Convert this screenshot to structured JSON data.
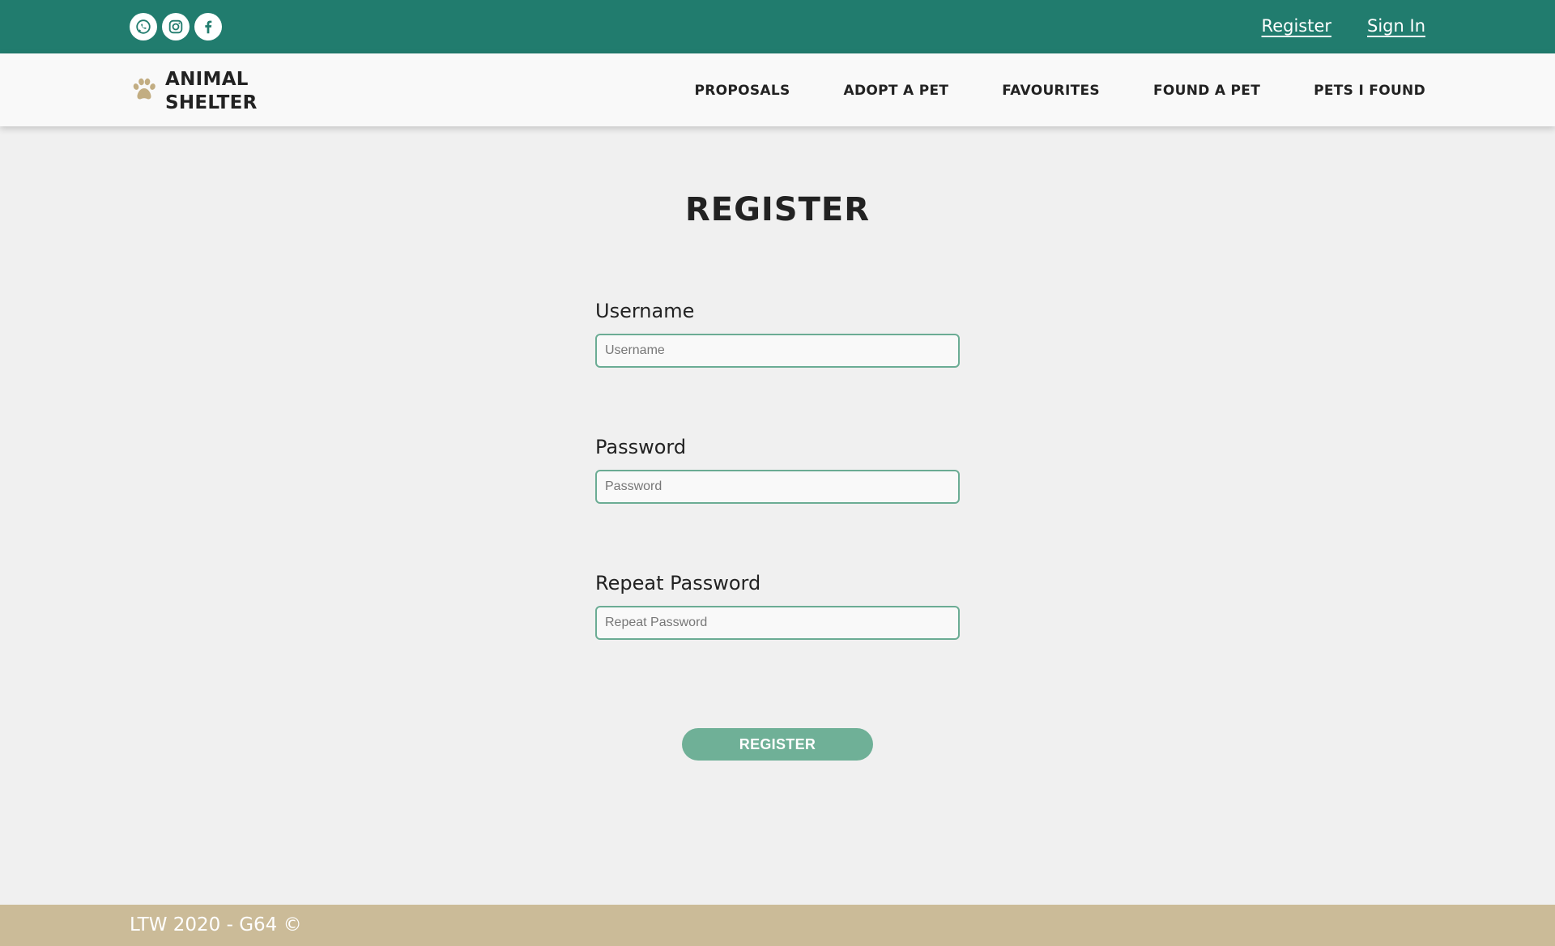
{
  "header": {
    "socials": [
      {
        "icon": "whatsapp-icon"
      },
      {
        "icon": "instagram-icon"
      },
      {
        "icon": "facebook-icon"
      }
    ],
    "register_link": "Register",
    "signin_link": "Sign In"
  },
  "brand": {
    "line1": "ANIMAL",
    "line2": "SHELTER",
    "icon": "paw-icon"
  },
  "nav": {
    "items": [
      "PROPOSALS",
      "ADOPT A PET",
      "FAVOURITES",
      "FOUND A PET",
      "PETS I FOUND"
    ]
  },
  "main": {
    "title": "REGISTER",
    "fields": [
      {
        "label": "Username",
        "placeholder": "Username",
        "value": ""
      },
      {
        "label": "Password",
        "placeholder": "Password",
        "value": ""
      },
      {
        "label": "Repeat Password",
        "placeholder": "Repeat Password",
        "value": ""
      }
    ],
    "submit_label": "REGISTER"
  },
  "footer": {
    "text": "LTW 2020 - G64 ©"
  },
  "colors": {
    "topbar": "#217c6e",
    "accent": "#6fb097",
    "footer": "#cbbb98",
    "paw": "#c2ad82"
  }
}
